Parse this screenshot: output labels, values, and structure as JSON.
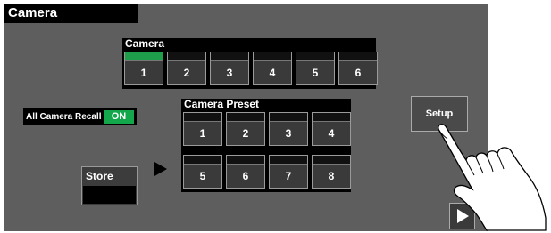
{
  "panel": {
    "title": "Camera"
  },
  "camera": {
    "header": "Camera",
    "buttons": [
      {
        "label": "1",
        "active": true
      },
      {
        "label": "2",
        "active": false
      },
      {
        "label": "3",
        "active": false
      },
      {
        "label": "4",
        "active": false
      },
      {
        "label": "5",
        "active": false
      },
      {
        "label": "6",
        "active": false
      }
    ]
  },
  "recall": {
    "label": "All Camera Recall",
    "state": "ON"
  },
  "preset": {
    "header": "Camera Preset",
    "buttons": [
      "1",
      "2",
      "3",
      "4",
      "5",
      "6",
      "7",
      "8"
    ]
  },
  "store": {
    "label": "Store"
  },
  "setup": {
    "label": "Setup"
  },
  "icons": {
    "store_arrow": "triangle-right-icon",
    "next": "play-icon",
    "hand": "pointing-hand-icon"
  },
  "colors": {
    "panel": "#5e5e5e",
    "tally_active": "#1e9e4a",
    "on_badge": "#13a64b"
  }
}
